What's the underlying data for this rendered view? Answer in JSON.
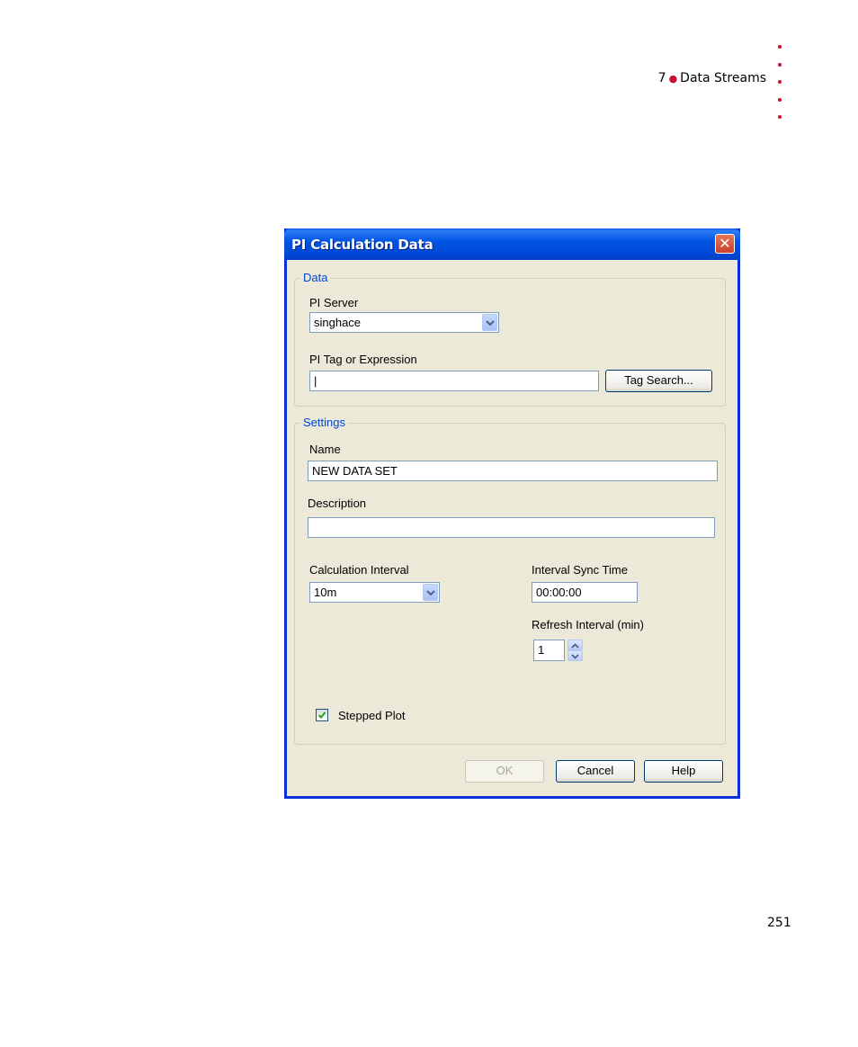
{
  "page": {
    "chapter_number": "7",
    "chapter_title": "Data Streams",
    "page_number": "251"
  },
  "dialog": {
    "title": "PI Calculation Data",
    "data_group": {
      "legend": "Data",
      "pi_server_label": "PI Server",
      "pi_server_value": "singhace",
      "tag_label": "PI Tag or Expression",
      "tag_value": "|",
      "tag_search_button": "Tag Search..."
    },
    "settings_group": {
      "legend": "Settings",
      "name_label": "Name",
      "name_value": "NEW DATA SET",
      "description_label": "Description",
      "description_value": "",
      "calc_interval_label": "Calculation Interval",
      "calc_interval_value": "10m",
      "sync_time_label": "Interval Sync Time",
      "sync_time_value": "00:00:00",
      "refresh_label": "Refresh Interval (min)",
      "refresh_value": "1",
      "stepped_plot_label": "Stepped Plot",
      "stepped_plot_checked": true
    },
    "buttons": {
      "ok": "OK",
      "cancel": "Cancel",
      "help": "Help"
    }
  },
  "colors": {
    "accent": "#c8102e",
    "titlebar": "#0054e3",
    "legend": "#0046d5",
    "window_bg": "#ece9d8"
  }
}
